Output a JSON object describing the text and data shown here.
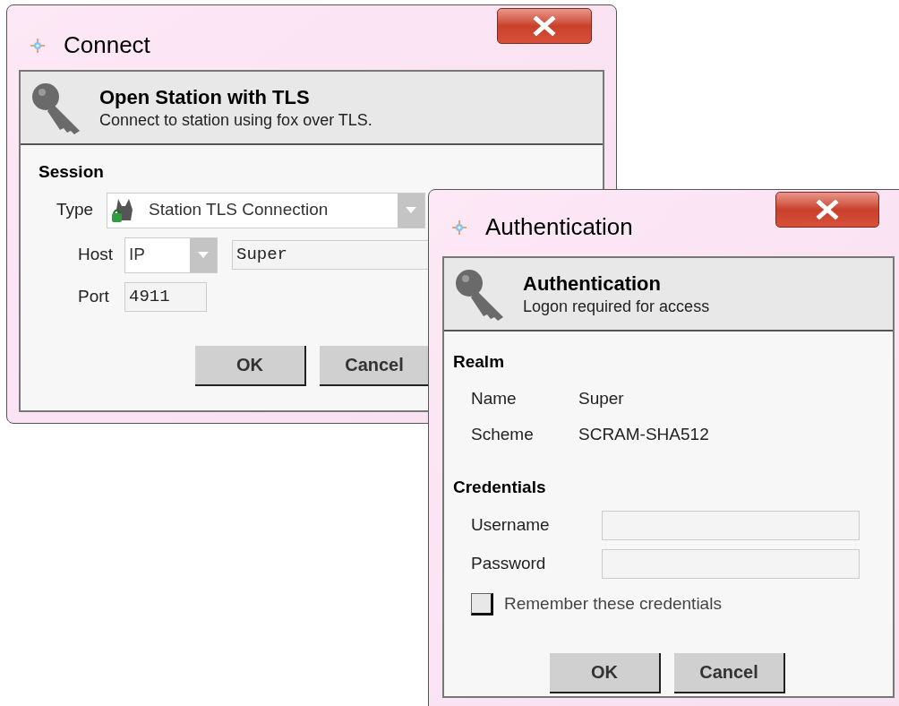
{
  "connect_dialog": {
    "title": "Connect",
    "header": {
      "title": "Open Station with TLS",
      "subtitle": "Connect to station using fox over TLS."
    },
    "section": "Session",
    "type": {
      "label": "Type",
      "value": "Station TLS Connection"
    },
    "host": {
      "label": "Host",
      "protocol": "IP",
      "value": "Super"
    },
    "port": {
      "label": "Port",
      "value": "4911"
    },
    "buttons": [
      "OK",
      "Cancel"
    ]
  },
  "auth_dialog": {
    "title": "Authentication",
    "header": {
      "title": "Authentication",
      "subtitle": "Logon required for access"
    },
    "realm": {
      "heading": "Realm",
      "rows": [
        {
          "label": "Name",
          "value": "Super"
        },
        {
          "label": "Scheme",
          "value": "SCRAM-SHA512"
        }
      ]
    },
    "credentials": {
      "heading": "Credentials",
      "fields": [
        {
          "label": "Username"
        },
        {
          "label": "Password"
        }
      ],
      "remember": {
        "label": "Remember these credentials",
        "checked": false
      }
    },
    "buttons": [
      "OK",
      "Cancel"
    ]
  }
}
